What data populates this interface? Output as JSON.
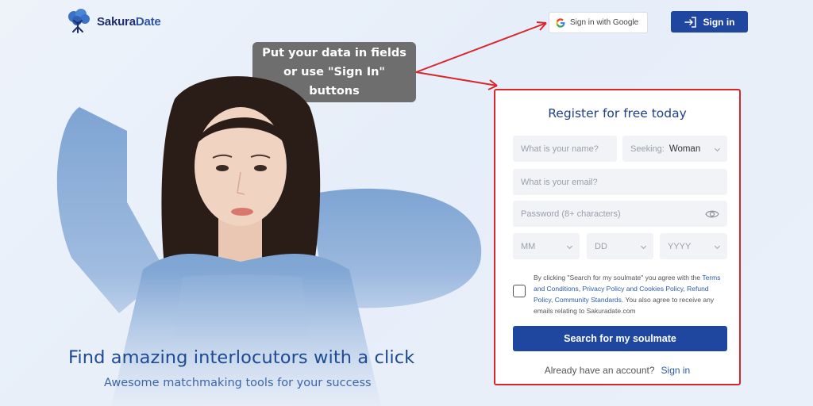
{
  "brand": {
    "name_part1": "Sakura",
    "name_part2": "Date"
  },
  "header": {
    "google_label": "Sign in with Google",
    "signin_label": "Sign in"
  },
  "callout": {
    "line1": "Put your data in fields",
    "line2": "or use \"Sign In\"",
    "line3": "buttons"
  },
  "hero": {
    "title": "Find amazing interlocutors with a click",
    "subtitle": "Awesome matchmaking tools for your success"
  },
  "form": {
    "title": "Register for free today",
    "name_placeholder": "What is your name?",
    "seeking_label": "Seeking:",
    "seeking_value": "Woman",
    "email_placeholder": "What is your email?",
    "password_placeholder": "Password (8+ characters)",
    "month_placeholder": "MM",
    "day_placeholder": "DD",
    "year_placeholder": "YYYY",
    "consent_prefix": "By clicking \"Search for my soulmate\" you agree with the ",
    "consent_link1": "Terms and Conditions",
    "consent_sep1": ", ",
    "consent_link2": "Privacy Policy and Cookies Policy",
    "consent_sep2": ", ",
    "consent_link3": "Refund Policy",
    "consent_sep3": ", ",
    "consent_link4": "Community Standards",
    "consent_suffix": ". You also agree to receive any emails relating to Sakuradate.com",
    "submit_label": "Search for my soulmate",
    "already_text": "Already have an account?",
    "already_link": "Sign in"
  },
  "colors": {
    "brand_blue": "#1f47a0",
    "annotation_red": "#d9262c",
    "callout_gray": "#6e6e6e"
  }
}
